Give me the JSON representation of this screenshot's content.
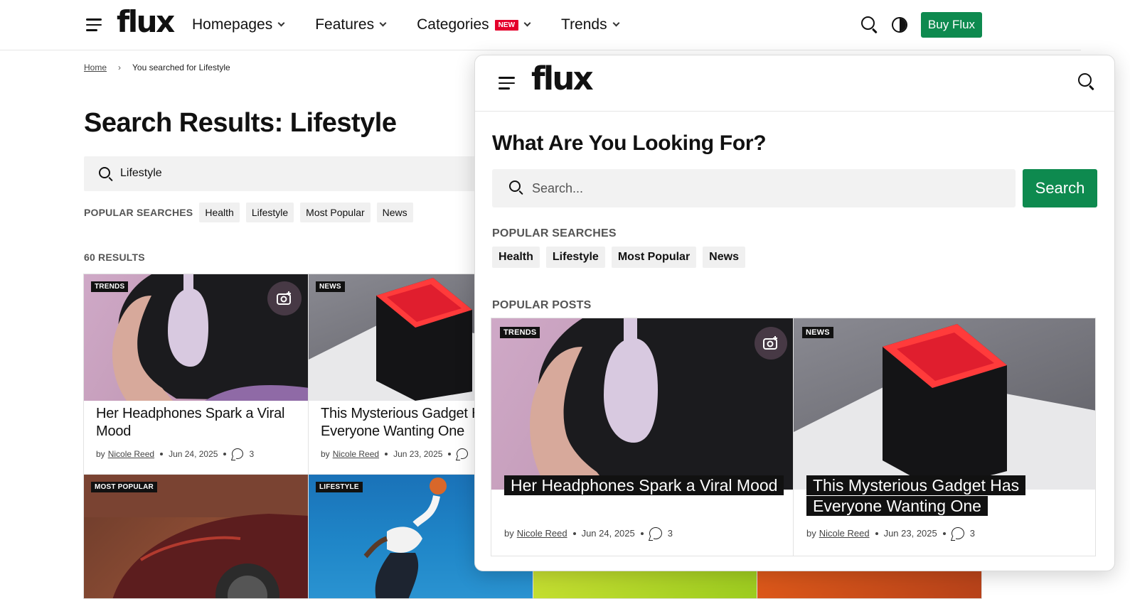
{
  "header": {
    "logo": "flux",
    "nav": [
      {
        "label": "Homepages"
      },
      {
        "label": "Features"
      },
      {
        "label": "Categories",
        "badge": "NEW"
      },
      {
        "label": "Trends"
      }
    ],
    "buy_button": "Buy Flux"
  },
  "breadcrumb": {
    "home": "Home",
    "sep": "›",
    "current": "You searched for Lifestyle"
  },
  "page_title": "Search Results: Lifestyle",
  "search": {
    "value": "Lifestyle"
  },
  "popular_searches": {
    "label": "POPULAR SEARCHES",
    "items": [
      "Health",
      "Lifestyle",
      "Most Popular",
      "News"
    ]
  },
  "results_count": "60 RESULTS",
  "results": [
    {
      "category": "TRENDS",
      "title": "Her Headphones Spark a Viral Mood",
      "by": "by",
      "author": "Nicole Reed",
      "date": "Jun 24, 2025",
      "comments": "3"
    },
    {
      "category": "NEWS",
      "title": "This Mysterious Gadget Has Everyone Wanting One",
      "by": "by",
      "author": "Nicole Reed",
      "date": "Jun 23, 2025",
      "comments": "3"
    },
    {
      "category": "MOST POPULAR"
    },
    {
      "category": "LIFESTYLE"
    }
  ],
  "panel": {
    "logo": "flux",
    "heading": "What Are You Looking For?",
    "placeholder": "Search...",
    "search_button": "Search",
    "popular_label": "POPULAR SEARCHES",
    "popular_items": [
      "Health",
      "Lifestyle",
      "Most Popular",
      "News"
    ],
    "posts_label": "POPULAR POSTS",
    "posts": [
      {
        "category": "TRENDS",
        "title": "Her Headphones Spark a Viral Mood",
        "by": "by",
        "author": "Nicole Reed",
        "date": "Jun 24, 2025",
        "comments": "3"
      },
      {
        "category": "NEWS",
        "title": "This Mysterious Gadget Has Everyone Wanting One",
        "by": "by",
        "author": "Nicole Reed",
        "date": "Jun 23, 2025",
        "comments": "3"
      }
    ]
  },
  "colors": {
    "accent": "#0e8a4f",
    "badge_new": "#e4002b",
    "tag_bg": "#111111"
  },
  "icons": [
    "menu-icon",
    "search-icon",
    "contrast-icon",
    "chevron-down-icon",
    "camera-icon",
    "comment-icon"
  ]
}
